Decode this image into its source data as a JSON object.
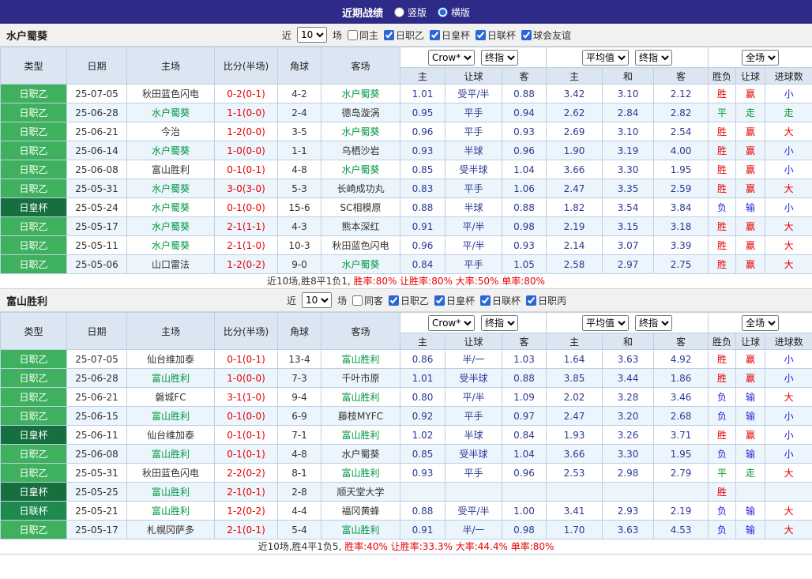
{
  "topbar": {
    "title": "近期战绩",
    "options": [
      {
        "label": "竖版",
        "selected": false
      },
      {
        "label": "横版",
        "selected": true
      }
    ]
  },
  "colors": {
    "topbar_bg": "#2d2b87",
    "header_bg": "#dce6f2",
    "row_alt_bg": "#ecf4fc",
    "league_light_green": "#3fb15e",
    "league_dark_green": "#166f3e",
    "win_red": "#e60000",
    "lose_blue": "#2424d8",
    "draw_green": "#009933",
    "odds_navy": "#2b3a94",
    "team_highlight_green": "#009944"
  },
  "tables": [
    {
      "team": "水户蜀葵",
      "filter": {
        "near_label": "近",
        "count": "10",
        "games_label": "场",
        "same_label": "同主",
        "same_checked": false,
        "leagues": [
          "日职乙",
          "日皇杯",
          "日联杯",
          "球会友谊"
        ]
      },
      "header": {
        "main": [
          "类型",
          "日期",
          "主场",
          "比分(半场)",
          "角球",
          "客场"
        ],
        "selects": [
          "Crow*",
          "终指",
          "平均值",
          "终指",
          "全场"
        ],
        "sub": [
          "主",
          "让球",
          "客",
          "主",
          "和",
          "客",
          "胜负",
          "让球",
          "进球数"
        ]
      },
      "rows": [
        {
          "league": "日职乙",
          "lcls": "lt",
          "date": "25-07-05",
          "home": "秋田蓝色闪电",
          "hh": false,
          "score": "0-2(0-1)",
          "corner": "4-2",
          "away": "水户蜀葵",
          "ah": true,
          "w1": "1.01",
          "hc": "受平/半",
          "w2": "0.88",
          "m1": "3.42",
          "m2": "3.10",
          "m3": "2.12",
          "res": [
            "胜",
            "赢",
            "小"
          ],
          "rc": [
            "r",
            "r",
            "b"
          ]
        },
        {
          "league": "日职乙",
          "lcls": "lt",
          "date": "25-06-28",
          "home": "水户蜀葵",
          "hh": true,
          "score": "1-1(0-0)",
          "corner": "2-4",
          "away": "德岛漩涡",
          "ah": false,
          "w1": "0.95",
          "hc": "平手",
          "w2": "0.94",
          "m1": "2.62",
          "m2": "2.84",
          "m3": "2.82",
          "res": [
            "平",
            "走",
            "走"
          ],
          "rc": [
            "g",
            "g",
            "g"
          ]
        },
        {
          "league": "日职乙",
          "lcls": "lt",
          "date": "25-06-21",
          "home": "今治",
          "hh": false,
          "score": "1-2(0-0)",
          "corner": "3-5",
          "away": "水户蜀葵",
          "ah": true,
          "w1": "0.96",
          "hc": "平手",
          "w2": "0.93",
          "m1": "2.69",
          "m2": "3.10",
          "m3": "2.54",
          "res": [
            "胜",
            "赢",
            "大"
          ],
          "rc": [
            "r",
            "r",
            "r"
          ]
        },
        {
          "league": "日职乙",
          "lcls": "lt",
          "date": "25-06-14",
          "home": "水户蜀葵",
          "hh": true,
          "score": "1-0(0-0)",
          "corner": "1-1",
          "away": "乌栖沙岩",
          "ah": false,
          "w1": "0.93",
          "hc": "半球",
          "w2": "0.96",
          "m1": "1.90",
          "m2": "3.19",
          "m3": "4.00",
          "res": [
            "胜",
            "赢",
            "小"
          ],
          "rc": [
            "r",
            "r",
            "b"
          ]
        },
        {
          "league": "日职乙",
          "lcls": "lt",
          "date": "25-06-08",
          "home": "富山胜利",
          "hh": false,
          "score": "0-1(0-1)",
          "corner": "4-8",
          "away": "水户蜀葵",
          "ah": true,
          "w1": "0.85",
          "hc": "受半球",
          "w2": "1.04",
          "m1": "3.66",
          "m2": "3.30",
          "m3": "1.95",
          "res": [
            "胜",
            "赢",
            "小"
          ],
          "rc": [
            "r",
            "r",
            "b"
          ]
        },
        {
          "league": "日职乙",
          "lcls": "lt",
          "date": "25-05-31",
          "home": "水户蜀葵",
          "hh": true,
          "score": "3-0(3-0)",
          "corner": "5-3",
          "away": "长崎成功丸",
          "ah": false,
          "w1": "0.83",
          "hc": "平手",
          "w2": "1.06",
          "m1": "2.47",
          "m2": "3.35",
          "m3": "2.59",
          "res": [
            "胜",
            "赢",
            "大"
          ],
          "rc": [
            "r",
            "r",
            "r"
          ]
        },
        {
          "league": "日皇杯",
          "lcls": "dk",
          "date": "25-05-24",
          "home": "水户蜀葵",
          "hh": true,
          "score": "0-1(0-0)",
          "corner": "15-6",
          "away": "SC相模原",
          "ah": false,
          "w1": "0.88",
          "hc": "半球",
          "w2": "0.88",
          "m1": "1.82",
          "m2": "3.54",
          "m3": "3.84",
          "res": [
            "负",
            "输",
            "小"
          ],
          "rc": [
            "b",
            "b",
            "b"
          ]
        },
        {
          "league": "日职乙",
          "lcls": "lt",
          "date": "25-05-17",
          "home": "水户蜀葵",
          "hh": true,
          "score": "2-1(1-1)",
          "corner": "4-3",
          "away": "熊本深红",
          "ah": false,
          "w1": "0.91",
          "hc": "平/半",
          "w2": "0.98",
          "m1": "2.19",
          "m2": "3.15",
          "m3": "3.18",
          "res": [
            "胜",
            "赢",
            "大"
          ],
          "rc": [
            "r",
            "r",
            "r"
          ]
        },
        {
          "league": "日职乙",
          "lcls": "lt",
          "date": "25-05-11",
          "home": "水户蜀葵",
          "hh": true,
          "score": "2-1(1-0)",
          "corner": "10-3",
          "away": "秋田蓝色闪电",
          "ah": false,
          "w1": "0.96",
          "hc": "平/半",
          "w2": "0.93",
          "m1": "2.14",
          "m2": "3.07",
          "m3": "3.39",
          "res": [
            "胜",
            "赢",
            "大"
          ],
          "rc": [
            "r",
            "r",
            "r"
          ]
        },
        {
          "league": "日职乙",
          "lcls": "lt",
          "date": "25-05-06",
          "home": "山口雷法",
          "hh": false,
          "score": "1-2(0-2)",
          "corner": "9-0",
          "away": "水户蜀葵",
          "ah": true,
          "w1": "0.84",
          "hc": "平手",
          "w2": "1.05",
          "m1": "2.58",
          "m2": "2.97",
          "m3": "2.75",
          "res": [
            "胜",
            "赢",
            "大"
          ],
          "rc": [
            "r",
            "r",
            "r"
          ]
        }
      ],
      "summary": [
        {
          "text": "近10场,胜8平1负1, ",
          "red": false
        },
        {
          "text": "胜率:80% 让胜率:80% 大率:50% 单率:80%",
          "red": true
        }
      ]
    },
    {
      "team": "富山胜利",
      "filter": {
        "near_label": "近",
        "count": "10",
        "games_label": "场",
        "same_label": "同客",
        "same_checked": false,
        "leagues": [
          "日职乙",
          "日皇杯",
          "日联杯",
          "日职丙"
        ]
      },
      "header": {
        "main": [
          "类型",
          "日期",
          "主场",
          "比分(半场)",
          "角球",
          "客场"
        ],
        "selects": [
          "Crow*",
          "终指",
          "平均值",
          "终指",
          "全场"
        ],
        "sub": [
          "主",
          "让球",
          "客",
          "主",
          "和",
          "客",
          "胜负",
          "让球",
          "进球数"
        ]
      },
      "rows": [
        {
          "league": "日职乙",
          "lcls": "lt",
          "date": "25-07-05",
          "home": "仙台维加泰",
          "hh": false,
          "score": "0-1(0-1)",
          "corner": "13-4",
          "away": "富山胜利",
          "ah": true,
          "w1": "0.86",
          "hc": "半/一",
          "w2": "1.03",
          "m1": "1.64",
          "m2": "3.63",
          "m3": "4.92",
          "res": [
            "胜",
            "赢",
            "小"
          ],
          "rc": [
            "r",
            "r",
            "b"
          ]
        },
        {
          "league": "日职乙",
          "lcls": "lt",
          "date": "25-06-28",
          "home": "富山胜利",
          "hh": true,
          "score": "1-0(0-0)",
          "corner": "7-3",
          "away": "千叶市原",
          "ah": false,
          "w1": "1.01",
          "hc": "受半球",
          "w2": "0.88",
          "m1": "3.85",
          "m2": "3.44",
          "m3": "1.86",
          "res": [
            "胜",
            "赢",
            "小"
          ],
          "rc": [
            "r",
            "r",
            "b"
          ]
        },
        {
          "league": "日职乙",
          "lcls": "lt",
          "date": "25-06-21",
          "home": "磐城FC",
          "hh": false,
          "score": "3-1(1-0)",
          "corner": "9-4",
          "away": "富山胜利",
          "ah": true,
          "w1": "0.80",
          "hc": "平/半",
          "w2": "1.09",
          "m1": "2.02",
          "m2": "3.28",
          "m3": "3.46",
          "res": [
            "负",
            "输",
            "大"
          ],
          "rc": [
            "b",
            "b",
            "r"
          ]
        },
        {
          "league": "日职乙",
          "lcls": "lt",
          "date": "25-06-15",
          "home": "富山胜利",
          "hh": true,
          "score": "0-1(0-0)",
          "corner": "6-9",
          "away": "藤枝MYFC",
          "ah": false,
          "w1": "0.92",
          "hc": "平手",
          "w2": "0.97",
          "m1": "2.47",
          "m2": "3.20",
          "m3": "2.68",
          "res": [
            "负",
            "输",
            "小"
          ],
          "rc": [
            "b",
            "b",
            "b"
          ]
        },
        {
          "league": "日皇杯",
          "lcls": "dk",
          "date": "25-06-11",
          "home": "仙台维加泰",
          "hh": false,
          "score": "0-1(0-1)",
          "corner": "7-1",
          "away": "富山胜利",
          "ah": true,
          "w1": "1.02",
          "hc": "半球",
          "w2": "0.84",
          "m1": "1.93",
          "m2": "3.26",
          "m3": "3.71",
          "res": [
            "胜",
            "赢",
            "小"
          ],
          "rc": [
            "r",
            "r",
            "b"
          ]
        },
        {
          "league": "日职乙",
          "lcls": "lt",
          "date": "25-06-08",
          "home": "富山胜利",
          "hh": true,
          "score": "0-1(0-1)",
          "corner": "4-8",
          "away": "水户蜀葵",
          "ah": false,
          "w1": "0.85",
          "hc": "受半球",
          "w2": "1.04",
          "m1": "3.66",
          "m2": "3.30",
          "m3": "1.95",
          "res": [
            "负",
            "输",
            "小"
          ],
          "rc": [
            "b",
            "b",
            "b"
          ]
        },
        {
          "league": "日职乙",
          "lcls": "lt",
          "date": "25-05-31",
          "home": "秋田蓝色闪电",
          "hh": false,
          "score": "2-2(0-2)",
          "corner": "8-1",
          "away": "富山胜利",
          "ah": true,
          "w1": "0.93",
          "hc": "平手",
          "w2": "0.96",
          "m1": "2.53",
          "m2": "2.98",
          "m3": "2.79",
          "res": [
            "平",
            "走",
            "大"
          ],
          "rc": [
            "g",
            "g",
            "r"
          ]
        },
        {
          "league": "日皇杯",
          "lcls": "dk",
          "date": "25-05-25",
          "home": "富山胜利",
          "hh": true,
          "score": "2-1(0-1)",
          "corner": "2-8",
          "away": "顺天堂大学",
          "ah": false,
          "w1": "",
          "hc": "",
          "w2": "",
          "m1": "",
          "m2": "",
          "m3": "",
          "res": [
            "胜",
            "",
            ""
          ],
          "rc": [
            "r",
            "",
            ""
          ]
        },
        {
          "league": "日联杯",
          "lcls": "md",
          "date": "25-05-21",
          "home": "富山胜利",
          "hh": true,
          "score": "1-2(0-2)",
          "corner": "4-4",
          "away": "福冈黄蜂",
          "ah": false,
          "w1": "0.88",
          "hc": "受平/半",
          "w2": "1.00",
          "m1": "3.41",
          "m2": "2.93",
          "m3": "2.19",
          "res": [
            "负",
            "输",
            "大"
          ],
          "rc": [
            "b",
            "b",
            "r"
          ]
        },
        {
          "league": "日职乙",
          "lcls": "lt",
          "date": "25-05-17",
          "home": "札幌冈萨多",
          "hh": false,
          "score": "2-1(0-1)",
          "corner": "5-4",
          "away": "富山胜利",
          "ah": true,
          "w1": "0.91",
          "hc": "半/一",
          "w2": "0.98",
          "m1": "1.70",
          "m2": "3.63",
          "m3": "4.53",
          "res": [
            "负",
            "输",
            "大"
          ],
          "rc": [
            "b",
            "b",
            "r"
          ]
        }
      ],
      "summary": [
        {
          "text": "近10场,胜4平1负5, ",
          "red": false
        },
        {
          "text": "胜率:40% 让胜率:33.3% 大率:44.4% 单率:80%",
          "red": true
        }
      ]
    }
  ]
}
